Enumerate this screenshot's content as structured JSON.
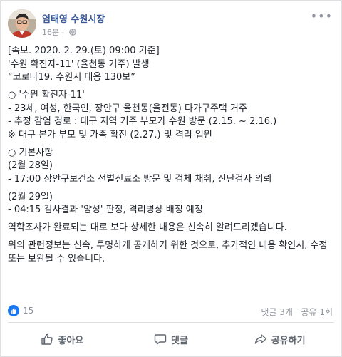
{
  "post": {
    "author": "염태영 수원시장",
    "time": "16분",
    "privacy_icon": "globe-icon",
    "more_icon": "more-options-icon",
    "lines": [
      "[속보. 2020. 2. 29.(토) 09:00 기준]",
      "'수원 확진자-11' (율천동 거주) 발생",
      "“코로나19. 수원시 대응 130보”",
      "",
      "○ '수원 확진자-11'",
      "- 23세, 여성, 한국인, 장안구 율천동(율전동) 다가구주택 거주",
      "- 추정 감염 경로 : 대구 지역 거주 부모가 수원 방문 (2.15. ~ 2.16.)",
      "※ 대구 본가 부모 및 가족 확진 (2.27.) 및 격리 입원",
      "",
      "○ 기본사항",
      "(2월 28일)",
      "- 17:00 장안구보건소 선별진료소 방문 및 검체 채취, 진단검사 의뢰",
      "",
      "(2월 29일)",
      "- 04:15 검사결과 '양성' 판정, 격리병상 배정 예정",
      "",
      "역학조사가 완료되는 대로 보다 상세한 내용은 신속히 알려드리겠습니다.",
      "",
      "위의 관련정보는 신속, 투명하게 공개하기 위한 것으로, 추가적인 내용 확인시, 수정 또는 보완될 수 있습니다."
    ]
  },
  "stats": {
    "likes": "15",
    "comments": "댓글 3개",
    "shares": "공유 1회"
  },
  "actions": {
    "like": "좋아요",
    "comment": "댓글",
    "share": "공유하기"
  },
  "colors": {
    "author": "#385898",
    "like_badge": "#1877f2",
    "text": "#1d2129",
    "muted": "#90949c"
  }
}
